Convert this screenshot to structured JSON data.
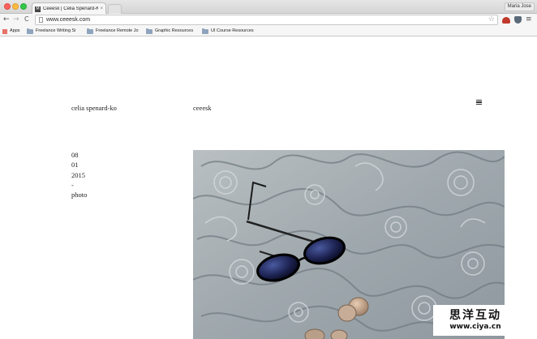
{
  "browser": {
    "tab_title": "Ceeesk | Celia Spenard-Ko",
    "tab_close": "×",
    "profile_name": "Maria Jose",
    "url": "www.ceeesk.com",
    "back_glyph": "←",
    "forward_glyph": "→",
    "reload_glyph": "C",
    "star_glyph": "☆",
    "menu_glyph": "≡",
    "bookmarks": [
      {
        "label": "Apps",
        "icon": "apps-grid-icon"
      },
      {
        "label": "Freelance Writing Si",
        "icon": "folder-icon"
      },
      {
        "label": "Freelance Remote Jo",
        "icon": "folder-icon"
      },
      {
        "label": "Graphic Resources",
        "icon": "folder-icon"
      },
      {
        "label": "UI Course Resources",
        "icon": "folder-icon"
      }
    ]
  },
  "site": {
    "name": "celia spenard-ko",
    "brand": "ceeesk",
    "menu_icon": "hamburger-menu-icon"
  },
  "post": {
    "month": "08",
    "day": "01",
    "year": "2015",
    "separator": "-",
    "category": "photo",
    "image": "sunglasses-on-carved-stone-photo"
  },
  "watermark": {
    "chinese": "思洋互动",
    "url": "www.ciya.cn"
  },
  "colors": {
    "tab_active": "#f6f6f6",
    "toolbar": "#f6f6f6",
    "text": "#222222",
    "photo_stone": "#a8b0b5"
  }
}
